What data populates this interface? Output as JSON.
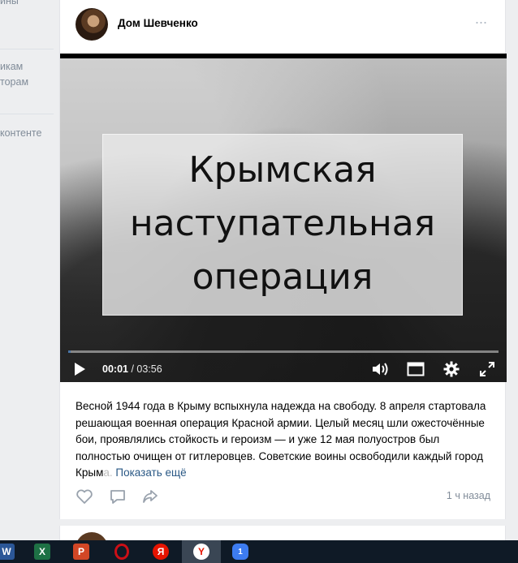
{
  "sidebar": {
    "items": [
      {
        "label": "ины"
      },
      {
        "label": "икам"
      },
      {
        "label": "торам"
      },
      {
        "label": "контенте"
      }
    ]
  },
  "post": {
    "author": "Дом Шевченко",
    "more_glyph": "···",
    "video": {
      "title_lines": [
        "Крымская",
        "наступательная",
        "операция"
      ],
      "current_time": "00:01",
      "separator": " / ",
      "total_time": "03:56",
      "progress_fraction": 0.005
    },
    "text": "Весной 1944 года в Крыму вспыхнула надежда на свободу. 8 апреля стартовала решающая военная операция Красной армии. Целый месяц шли ожесточённые бои, проявлялись стойкость и героизм — и уже 12 мая полуостров был полностью очищен от гитлеровцев. Советские воины освободили каждый город Крым",
    "text_fade": "а.",
    "show_more": "Показать ещё",
    "time_ago": "1 ч назад"
  },
  "taskbar": {
    "items": [
      {
        "icon": "word-icon",
        "label": "W",
        "color": "#2b5797"
      },
      {
        "icon": "excel-icon",
        "label": "X",
        "color": "#1e7145"
      },
      {
        "icon": "powerpoint-icon",
        "label": "P",
        "color": "#d24726"
      },
      {
        "icon": "opera-icon",
        "label": "O",
        "color": "#cc0f16"
      },
      {
        "icon": "yandex-icon",
        "label": "Я",
        "color": "#e61400"
      },
      {
        "icon": "yandex-browser-icon",
        "label": "Y",
        "color": "#ffffff"
      },
      {
        "icon": "app-icon",
        "label": "1",
        "color": "#3d7cf0"
      }
    ]
  }
}
